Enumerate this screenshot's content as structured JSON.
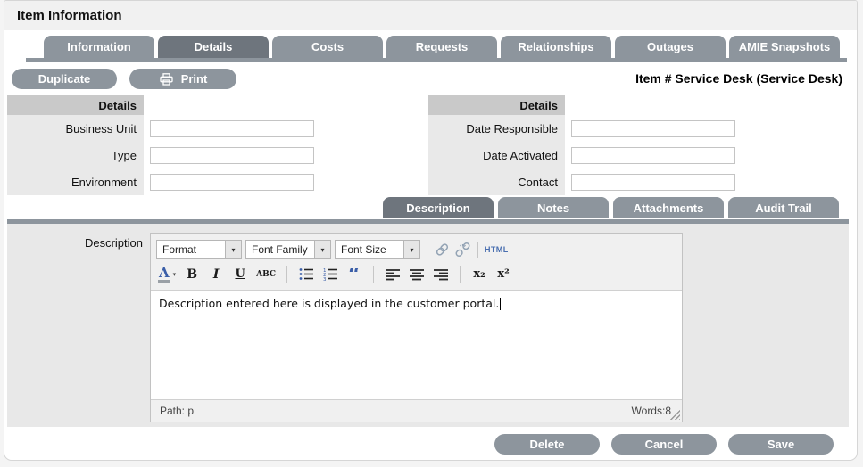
{
  "page": {
    "title": "Item Information"
  },
  "main_tabs": [
    {
      "label": "Information"
    },
    {
      "label": "Details"
    },
    {
      "label": "Costs"
    },
    {
      "label": "Requests"
    },
    {
      "label": "Relationships"
    },
    {
      "label": "Outages"
    },
    {
      "label": "AMIE Snapshots"
    }
  ],
  "actions": {
    "duplicate": "Duplicate",
    "print": "Print",
    "item_reference": "Item # Service Desk (Service Desk)"
  },
  "details_left": {
    "header": "Details",
    "fields": [
      {
        "label": "Business Unit",
        "value": ""
      },
      {
        "label": "Type",
        "value": ""
      },
      {
        "label": "Environment",
        "value": ""
      }
    ]
  },
  "details_right": {
    "header": "Details",
    "fields": [
      {
        "label": "Date Responsible",
        "value": ""
      },
      {
        "label": "Date Activated",
        "value": ""
      },
      {
        "label": "Contact",
        "value": ""
      }
    ]
  },
  "sub_tabs": [
    {
      "label": "Description"
    },
    {
      "label": "Notes"
    },
    {
      "label": "Attachments"
    },
    {
      "label": "Audit Trail"
    }
  ],
  "editor": {
    "field_label": "Description",
    "dropdowns": {
      "format": "Format",
      "font_family": "Font Family",
      "font_size": "Font Size",
      "arrow": "▾"
    },
    "icons": {
      "html": "HTML",
      "font_color_letter": "A",
      "bold": "B",
      "italic": "I",
      "underline": "U",
      "strikethrough": "ABC",
      "blockquote": "“",
      "subscript": "x₂",
      "superscript": "x²"
    },
    "content": "Description entered here is displayed in the customer portal.",
    "status": {
      "path": "Path: p",
      "words": "Words:8"
    }
  },
  "footer": {
    "delete": "Delete",
    "cancel": "Cancel",
    "save": "Save"
  },
  "colors": {
    "tab_inactive": "#8d959d",
    "tab_active": "#6e757d",
    "panel_header_bg": "#c9c9c9",
    "panel_label_bg": "#e9e9e9",
    "editor_panel_bg": "#e8e8e8",
    "toolbar_bg": "#f0f0f0",
    "accent_blue": "#3a5ea8"
  }
}
